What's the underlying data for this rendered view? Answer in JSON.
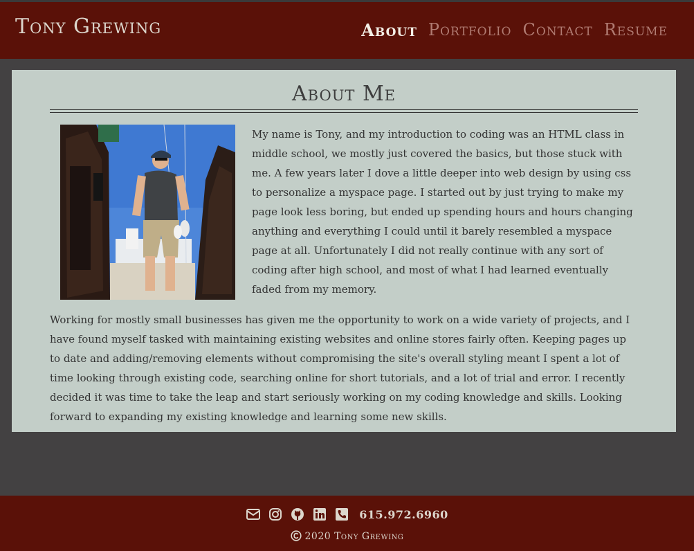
{
  "header": {
    "brand": "Tony Grewing",
    "nav": [
      {
        "label": "About",
        "active": true
      },
      {
        "label": "Portfolio",
        "active": false
      },
      {
        "label": "Contact",
        "active": false
      },
      {
        "label": "Resume",
        "active": false
      }
    ]
  },
  "main": {
    "title": "About Me",
    "paragraphs": [
      "My name is Tony, and my introduction to coding was an HTML class in middle school, we mostly just covered the basics, but those stuck with me. A few years later I dove a little deeper into web design by using css to personalize a myspace page. I started out by just trying to make my page look less boring, but ended up spending hours and hours changing anything and everything I could until it barely resembled a myspace page at all. Unfortunately I did not really continue with any sort of coding after high school, and most of what I had learned eventually faded from my memory.",
      "Working for mostly small businesses has given me the opportunity to work on a wide variety of projects, and I have found myself tasked with maintaining existing websites and online stores fairly often. Keeping pages up to date and adding/removing elements without compromising the site's overall styling meant I spent a lot of time looking through existing code, searching online for short tutorials, and a lot of trial and error. I recently decided it was time to take the leap and start seriously working on my coding knowledge and skills. Looking forward to expanding my existing knowledge and learning some new skills."
    ]
  },
  "footer": {
    "icons": [
      "envelope-icon",
      "instagram-icon",
      "github-icon",
      "linkedin-icon",
      "phone-icon"
    ],
    "phone": "615.972.6960",
    "copyright": "2020 Tony Grewing"
  },
  "colors": {
    "header_bg": "#5a1108",
    "page_bg": "#434142",
    "card_bg": "#c3cec8",
    "nav_inactive": "#b07b72",
    "nav_active": "#f4efe6"
  }
}
